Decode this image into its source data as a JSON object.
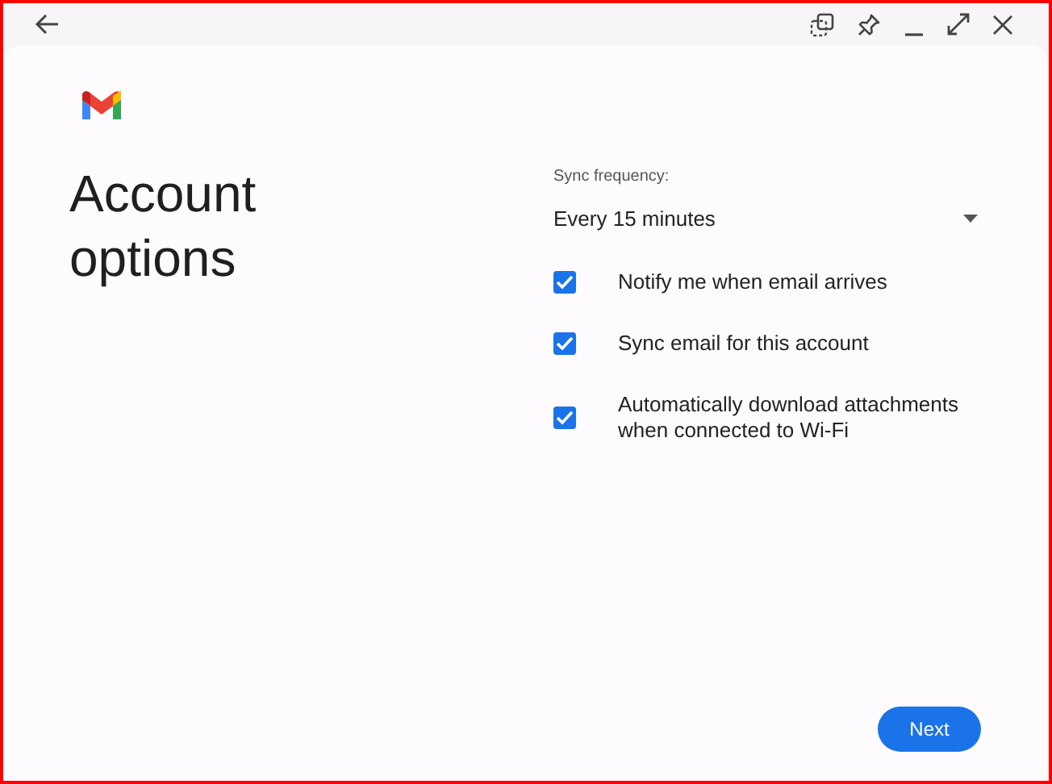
{
  "title": "Account options",
  "sync_frequency": {
    "label": "Sync frequency:",
    "value": "Every 15 minutes"
  },
  "options": [
    {
      "label": "Notify me when email arrives",
      "checked": true
    },
    {
      "label": "Sync email for this account",
      "checked": true
    },
    {
      "label": "Automatically download attachments when connected to Wi-Fi",
      "checked": true
    }
  ],
  "next_button": "Next"
}
